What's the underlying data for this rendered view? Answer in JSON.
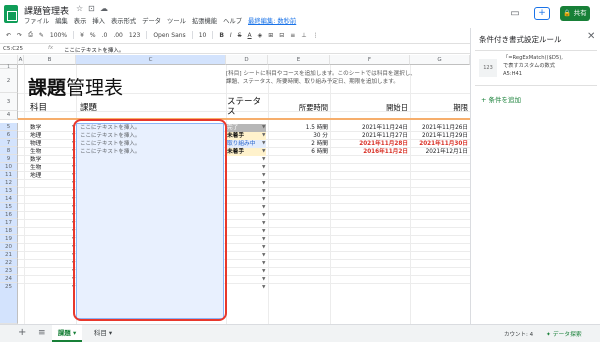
{
  "header": {
    "title": "課題管理表",
    "menus": [
      "ファイル",
      "編集",
      "表示",
      "挿入",
      "表示形式",
      "データ",
      "ツール",
      "拡張機能",
      "ヘルプ",
      "最終編集: 数秒前"
    ],
    "share_label": "共有"
  },
  "toolbar": {
    "zoom": "100%",
    "currency": "¥",
    "percent": "%",
    "dec0": ".0",
    "dec00": ".00",
    "numfmt": "123",
    "font": "Open Sans",
    "size": "10",
    "bold": "B",
    "italic": "I",
    "strike": "S",
    "textcolor": "A"
  },
  "formula_bar": {
    "range": "C5:C25",
    "fx": "fx",
    "value": "ここにテキストを挿入。"
  },
  "grid": {
    "columns": [
      "A",
      "B",
      "C",
      "D",
      "E",
      "F",
      "G"
    ],
    "rows": [
      "1",
      "2",
      "3",
      "4",
      "5",
      "6",
      "7",
      "8",
      "9",
      "10",
      "11",
      "12",
      "13",
      "14",
      "15",
      "16",
      "17",
      "18",
      "19",
      "20",
      "21",
      "22",
      "23",
      "24",
      "25"
    ]
  },
  "sheet": {
    "title_bold": "課題",
    "title_rest": "管理表",
    "description": "[科目] シートに科目やコースを追加します。このシートでは科目を選択し、課題、ステータス、所要時間、取り組み予定日、期限を追加します。",
    "headers": {
      "subject": "科目",
      "task": "課題",
      "status": "ステータス",
      "duration": "所要時間",
      "start": "開始日",
      "due": "期限"
    },
    "rows": [
      {
        "subject": "数学",
        "task": "ここにテキストを挿入。",
        "status": "完了",
        "duration": "1.5 時間",
        "start": "2021年11月24日",
        "due": "2021年11月26日"
      },
      {
        "subject": "地理",
        "task": "ここにテキストを挿入。",
        "status": "未着手",
        "duration": "30 分",
        "start": "2021年11月27日",
        "due": "2021年11月29日"
      },
      {
        "subject": "物理",
        "task": "ここにテキストを挿入。",
        "status": "取り組み中",
        "duration": "2 時間",
        "start": "2021年11月28日",
        "due": "2021年11月30日"
      },
      {
        "subject": "生物",
        "task": "ここにテキストを挿入。",
        "status": "未着手",
        "duration": "6 時間",
        "start": "2016年11月2日",
        "due": "2021年12月1日"
      },
      {
        "subject": "数学",
        "task": "",
        "status": "",
        "duration": "",
        "start": "",
        "due": ""
      },
      {
        "subject": "生物",
        "task": "",
        "status": "",
        "duration": "",
        "start": "",
        "due": ""
      },
      {
        "subject": "地理",
        "task": "",
        "status": "",
        "duration": "",
        "start": "",
        "due": ""
      }
    ]
  },
  "bottom": {
    "tabs": [
      "課題",
      "科目"
    ],
    "count": "カウント: 4",
    "explore": "データ探索"
  },
  "panel": {
    "title": "条件付き書式設定ルール",
    "rule_badge": "123",
    "rule_formula": "「=RegExMatch(($D5),",
    "rule_desc": "で表すカスタムの数式",
    "rule_range": "A5:H41",
    "add_rule": "+  条件を追加"
  },
  "colors": {
    "accent_green": "#188038",
    "selection_blue": "#e8f0fe",
    "highlight_red": "#e8372c",
    "orange_rule": "#f6ae6c"
  }
}
